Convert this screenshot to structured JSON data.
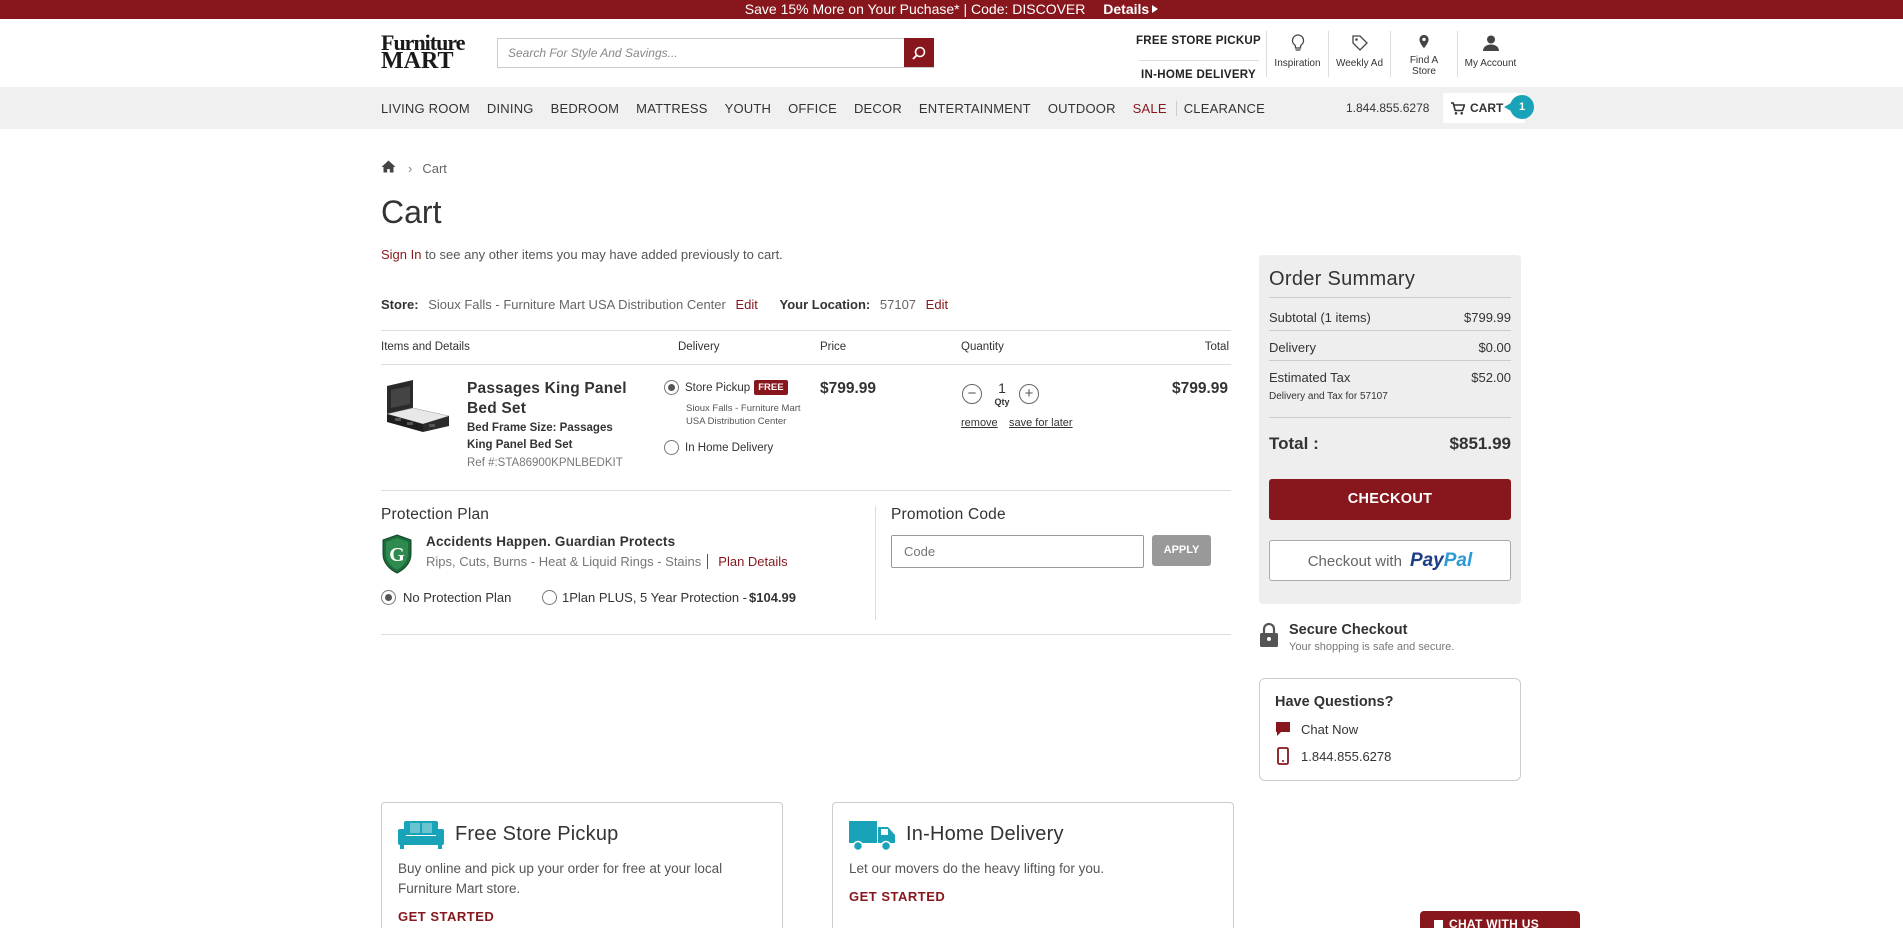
{
  "promo": {
    "text": "Save 15% More on Your Puchase* | Code: DISCOVER",
    "details": "Details"
  },
  "header": {
    "logo_line1": "Furniture",
    "logo_line2": "MART",
    "search_placeholder": "Search For Style And Savings...",
    "pickup_link": "FREE STORE PICKUP",
    "delivery_link": "IN-HOME DELIVERY",
    "icons": [
      {
        "label": "Inspiration",
        "icon": "lightbulb-icon"
      },
      {
        "label": "Weekly Ad",
        "icon": "tag-icon"
      },
      {
        "label": "Find A Store",
        "icon": "map-pin-icon"
      },
      {
        "label": "My Account",
        "icon": "user-icon"
      }
    ]
  },
  "nav": {
    "items": [
      "LIVING ROOM",
      "DINING",
      "BEDROOM",
      "MATTRESS",
      "YOUTH",
      "OFFICE",
      "DECOR",
      "ENTERTAINMENT",
      "OUTDOOR",
      "SALE",
      "CLEARANCE"
    ],
    "phone": "1.844.855.6278",
    "cart_label": "CART",
    "cart_count": "1"
  },
  "breadcrumb": {
    "current": "Cart"
  },
  "page": {
    "title": "Cart",
    "signin_link": "Sign In",
    "signin_text": " to see any other items you may have added previously to cart."
  },
  "store": {
    "label": "Store:",
    "name": "Sioux Falls - Furniture Mart USA Distribution Center",
    "edit": "Edit",
    "location_label": "Your Location:",
    "zip": "57107",
    "edit2": "Edit"
  },
  "table": {
    "headers": [
      "Items and Details",
      "Delivery",
      "Price",
      "Quantity",
      "Total"
    ]
  },
  "item": {
    "name": "Passages King Panel Bed Set",
    "attr": "Bed Frame Size: Passages King Panel Bed Set",
    "ref": "Ref #:STA86900KPNLBEDKIT",
    "delivery_opt1": "Store Pickup",
    "free_badge": "FREE",
    "pickup_location": "Sioux Falls - Furniture Mart USA Distribution Center",
    "delivery_opt2": "In Home Delivery",
    "price": "$799.99",
    "qty": "1",
    "qty_label": "Qty",
    "remove": "remove",
    "save_later": "save for later",
    "total": "$799.99"
  },
  "protection": {
    "title": "Protection Plan",
    "name": "Accidents Happen. Guardian Protects",
    "desc": "Rips, Cuts, Burns - Heat & Liquid Rings - Stains",
    "plan_details": "Plan Details",
    "opt1": "No Protection Plan",
    "opt2": "1Plan PLUS, 5 Year Protection - ",
    "opt2_price": "$104.99"
  },
  "promo_code": {
    "title": "Promotion Code",
    "placeholder": "Code",
    "apply": "APPLY"
  },
  "summary": {
    "title": "Order Summary",
    "subtotal_label": "Subtotal (1 items)",
    "subtotal": "$799.99",
    "delivery_label": "Delivery",
    "delivery": "$0.00",
    "tax_label": "Estimated Tax",
    "tax": "$52.00",
    "note": "Delivery and Tax for 57107",
    "total_label": "Total :",
    "total": "$851.99",
    "checkout": "CHECKOUT",
    "paypal_prefix": "Checkout with",
    "paypal_a": "Pay",
    "paypal_b": "Pal"
  },
  "secure": {
    "title": "Secure Checkout",
    "sub": "Your shopping is safe and secure."
  },
  "questions": {
    "title": "Have Questions?",
    "chat": "Chat Now",
    "phone": "1.844.855.6278"
  },
  "cards": [
    {
      "title": "Free Store Pickup",
      "text": "Buy online and pick up your order for free at your local Furniture Mart store.",
      "link": "GET STARTED"
    },
    {
      "title": "In-Home Delivery",
      "text": "Let our movers do the heavy lifting for you.",
      "link": "GET STARTED"
    }
  ],
  "chat_widget": "CHAT WITH US",
  "colors": {
    "brand": "#87171c",
    "accent": "#19a3b8",
    "gray_bg": "#f0f0f0"
  }
}
